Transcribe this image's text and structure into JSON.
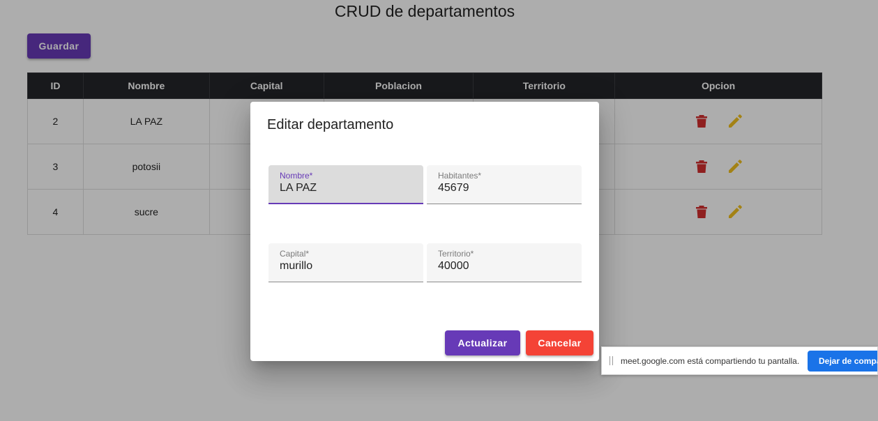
{
  "page": {
    "title": "CRUD de departamentos",
    "save_button": "Guardar"
  },
  "table": {
    "headers": [
      "ID",
      "Nombre",
      "Capital",
      "Poblacion",
      "Territorio",
      "Opcion"
    ],
    "rows": [
      {
        "id": "2",
        "nombre": "LA PAZ",
        "capital": "",
        "poblacion": "",
        "territorio": ""
      },
      {
        "id": "3",
        "nombre": "potosii",
        "capital": "",
        "poblacion": "",
        "territorio": ""
      },
      {
        "id": "4",
        "nombre": "sucre",
        "capital": "",
        "poblacion": "",
        "territorio": ""
      }
    ],
    "action_icons": [
      "delete-icon",
      "edit-icon"
    ]
  },
  "dialog": {
    "title": "Editar departamento",
    "fields": {
      "nombre": {
        "label": "Nombre*",
        "value": "LA PAZ"
      },
      "habitantes": {
        "label": "Habitantes*",
        "value": "45679"
      },
      "capital": {
        "label": "Capital*",
        "value": "murillo"
      },
      "territorio": {
        "label": "Territorio*",
        "value": "40000"
      }
    },
    "update_button": "Actualizar",
    "cancel_button": "Cancelar"
  },
  "share_bar": {
    "message": "meet.google.com está compartiendo tu pantalla.",
    "stop_button": "Dejar de compa"
  },
  "colors": {
    "primary": "#673ab7",
    "danger": "#f44336",
    "delete_icon": "#d32f2f",
    "edit_icon": "#f0c020",
    "table_header": "#24252a",
    "share_button": "#1a73e8"
  }
}
